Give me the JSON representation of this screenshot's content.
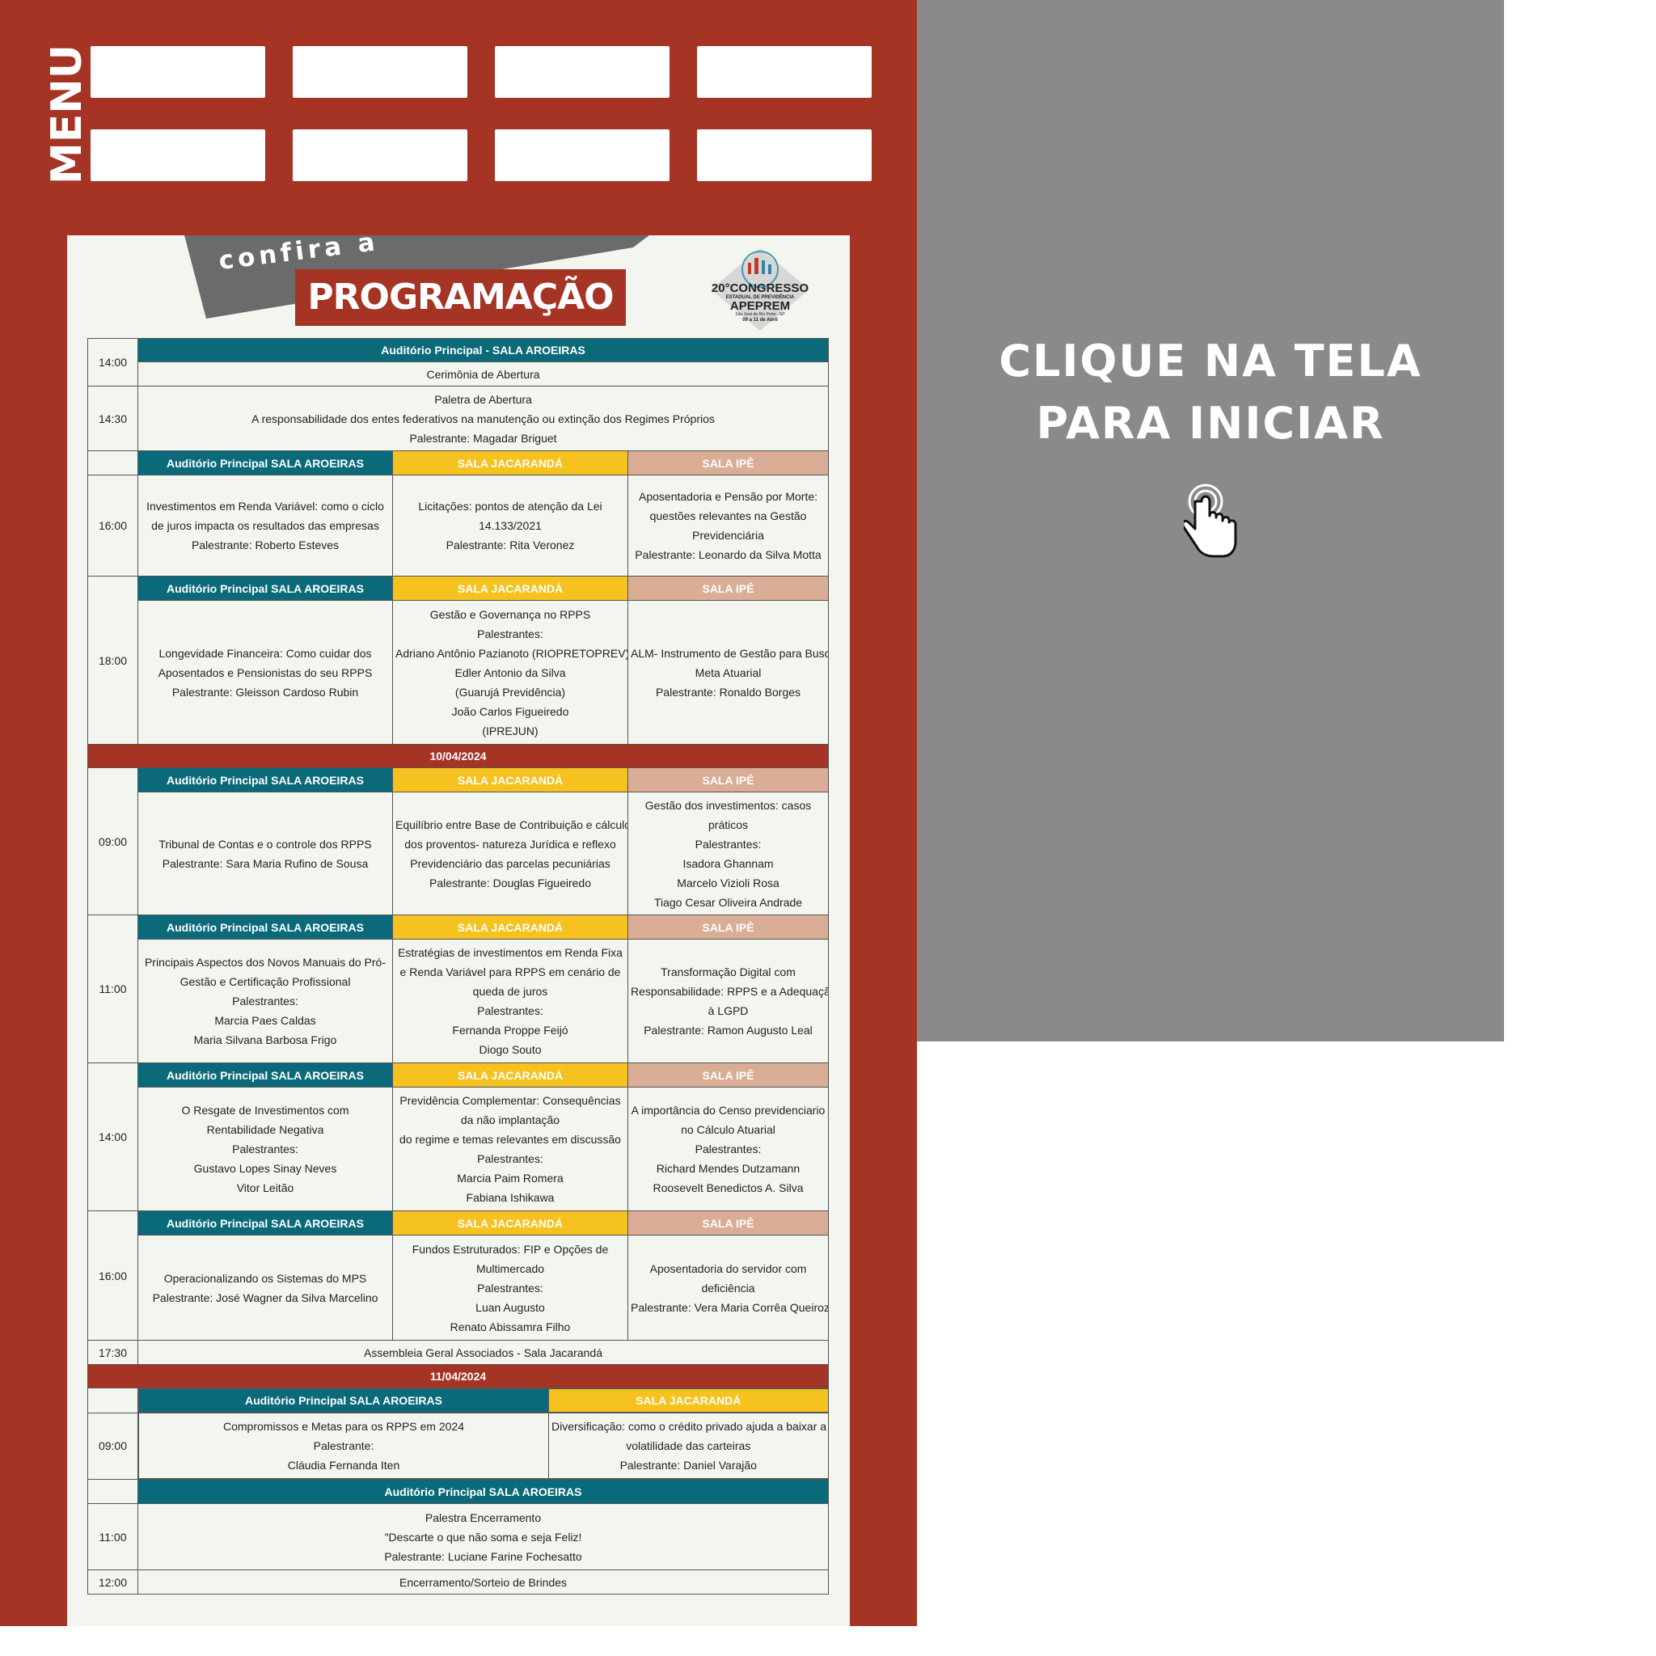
{
  "menu": {
    "label": "MENU",
    "buttons": [
      "",
      "",
      "",
      "",
      "",
      "",
      "",
      ""
    ]
  },
  "poster": {
    "header": {
      "confira": "confira a",
      "title": "PROGRAMAÇÃO",
      "logo_lines": [
        "20°CONGRESSO",
        "ESTADUAL DE PREVIDÊNCIA",
        "APEPREM",
        "São José do Rio Preto - SP",
        "09 a 11 de Abril"
      ]
    },
    "colors": {
      "teal": "#0b6a7a",
      "yellow": "#f5c220",
      "peach": "#d9ad96",
      "red": "#a53424"
    },
    "day1": {
      "r1": {
        "time": "14:00",
        "header": "Auditório Principal - SALA   AROEIRAS",
        "text": "Cerimônia de Abertura"
      },
      "r2": {
        "time": "14:30",
        "lines": [
          "Paletra de Abertura",
          "A responsabilidade dos entes federativos na manutenção ou   extinção dos Regimes Próprios",
          "Palestrante: Magadar Briguet"
        ]
      },
      "h3": [
        "Auditório Principal SALA AROEIRAS",
        "SALA JACARANDÁ",
        "SALA IPÊ"
      ],
      "r3": {
        "time": "16:00",
        "c1": [
          "Investimentos em Renda Variável: como o ciclo",
          "de juros impacta   os resultados das empresas",
          "Palestrante: Roberto Esteves"
        ],
        "c2": [
          "Licitações: pontos de atenção da Lei",
          "14.133/2021",
          "Palestrante: Rita Veronez"
        ],
        "c3": [
          "Aposentadoria e Pensão por Morte:",
          "questões relevantes na Gestão",
          "Previdenciária",
          "Palestrante: Leonardo da Silva Motta"
        ]
      },
      "h4": [
        "Auditório Principal SALA AROEIRAS",
        "SALA JACARANDÁ",
        "SALA IPÊ"
      ],
      "r4": {
        "time": "18:00",
        "c1": [
          "Longevidade   Financeira: Como cuidar dos",
          "Aposentados e Pensionistas do seu RPPS",
          "Palestrante: Gleisson Cardoso Rubin"
        ],
        "c2": [
          "Gestão e Governança no RPPS",
          "Palestrantes:",
          "Adriano Antônio Pazianoto (RIOPRETOPREV)",
          "Edler Antonio da Silva",
          "(Guarujá Previdência)",
          "João Carlos Figueiredo",
          "(IPREJUN)"
        ],
        "c3": [
          "ALM- Instrumento de Gestão para Busca",
          "Meta Atuarial",
          "Palestrante: Ronaldo Borges"
        ]
      }
    },
    "day2": {
      "date": "10/04/2024",
      "h1": [
        "Auditório   Principal   SALA AROEIRAS",
        "SALA JACARANDÁ",
        "SALA IPÊ"
      ],
      "r1": {
        "time": "09:00",
        "c1": [
          "Tribunal de Contas e o controle dos RPPS",
          "Palestrante: Sara Maria Rufino de Sousa"
        ],
        "c2": [
          "Equilíbrio entre Base de Contribuição e cálculo",
          "dos   proventos-  natureza Jurídica e reflexo",
          "Previdenciário das parcelas pecuniárias",
          "Palestrante: Douglas Figueiredo"
        ],
        "c3": [
          "Gestão dos investimentos: casos",
          "práticos",
          "Palestrantes:",
          "Isadora Ghannam",
          "Marcelo Vizioli Rosa",
          "Tiago Cesar Oliveira Andrade"
        ]
      },
      "h2": [
        "Auditório  Principal  SALA AROEIRAS",
        "SALA JACARANDÁ",
        "SALA IPÊ"
      ],
      "r2": {
        "time": "11:00",
        "c1": [
          "Principais Aspectos dos Novos Manuais do Pró-",
          "Gestão e   Certificação Profissional",
          "Palestrantes:",
          "Marcia Paes Caldas",
          "Maria Silvana Barbosa Frigo"
        ],
        "c2": [
          "Estratégias de investimentos em Renda Fixa",
          "e Renda  Variável para RPPS em cenário de",
          "queda de juros",
          "Palestrantes:",
          "Fernanda Proppe Feijó",
          "Diogo Souto"
        ],
        "c3": [
          "Transformação Digital com",
          "Responsabilidade: RPPS e a   Adequação",
          "à LGPD",
          "Palestrante: Ramon Augusto Leal"
        ]
      },
      "h3": [
        "Auditório Principal SALA AROEIRAS",
        "SALA JACARANDÁ",
        "SALA IPÊ"
      ],
      "r3": {
        "time": "14:00",
        "c1": [
          "O Resgate de Investimentos com",
          "Rentabilidade Negativa",
          "Palestrantes:",
          "Gustavo Lopes Sinay Neves",
          "Vitor Leitão"
        ],
        "c2": [
          "Previdência Complementar: Consequências",
          "da não implantação",
          "do regime e temas relevantes em discussão",
          "Palestrantes:",
          "Marcia Paim Romera",
          "Fabiana Ishikawa"
        ],
        "c3": [
          "A importância do Censo previdenciario",
          "no Cálculo Atuarial",
          "Palestrantes:",
          "Richard Mendes Dutzamann",
          "Roosevelt Benedictos A. Silva"
        ]
      },
      "h4": [
        "Auditório  Principal  SALA AROEIRAS",
        "SALA JACARANDÁ",
        "SALA IPÊ"
      ],
      "r4": {
        "time": "16:00",
        "c1": [
          "Operacionalizando os Sistemas do MPS",
          "Palestrante: José Wagner  da Silva Marcelino"
        ],
        "c2": [
          "Fundos Estruturados: FIP e Opções de",
          "Multimercado",
          "Palestrantes:",
          "Luan Augusto",
          "Renato Abissamra Filho"
        ],
        "c3": [
          "Aposentadoria do servidor com",
          "deficiência",
          "Palestrante: Vera Maria Corrêa Queiroz"
        ]
      },
      "r5": {
        "time": "17:30",
        "text": "Assembleia Geral Associados - Sala Jacarandá"
      }
    },
    "day3": {
      "date": "11/04/2024",
      "h1": [
        "Auditório  Principal  SALA AROEIRAS",
        "SALA  JACARANDÁ"
      ],
      "r1": {
        "time": "09:00",
        "c1": [
          "Compromissos e Metas para os RPPS em 2024",
          "Palestrante:",
          "Cláudia Fernanda Iten"
        ],
        "c2": [
          "Diversificação: como o crédito privado ajuda a baixar a",
          "volatilidade das carteiras",
          "Palestrante: Daniel Varajão"
        ]
      },
      "h2": "Auditório Principal   SALA AROEIRAS",
      "r2": {
        "time": "11:00",
        "lines": [
          "Palestra  Encerramento",
          "\"Descarte o que não soma e seja Feliz!",
          "Palestrante: Luciane Farine Fochesatto"
        ]
      },
      "r3": {
        "time": "12:00",
        "text": "Encerramento/Sorteio de Brindes"
      }
    }
  },
  "start_panel": {
    "line1": "CLIQUE NA TELA",
    "line2": "PARA INICIAR",
    "icon": "pointer-hand-icon"
  }
}
